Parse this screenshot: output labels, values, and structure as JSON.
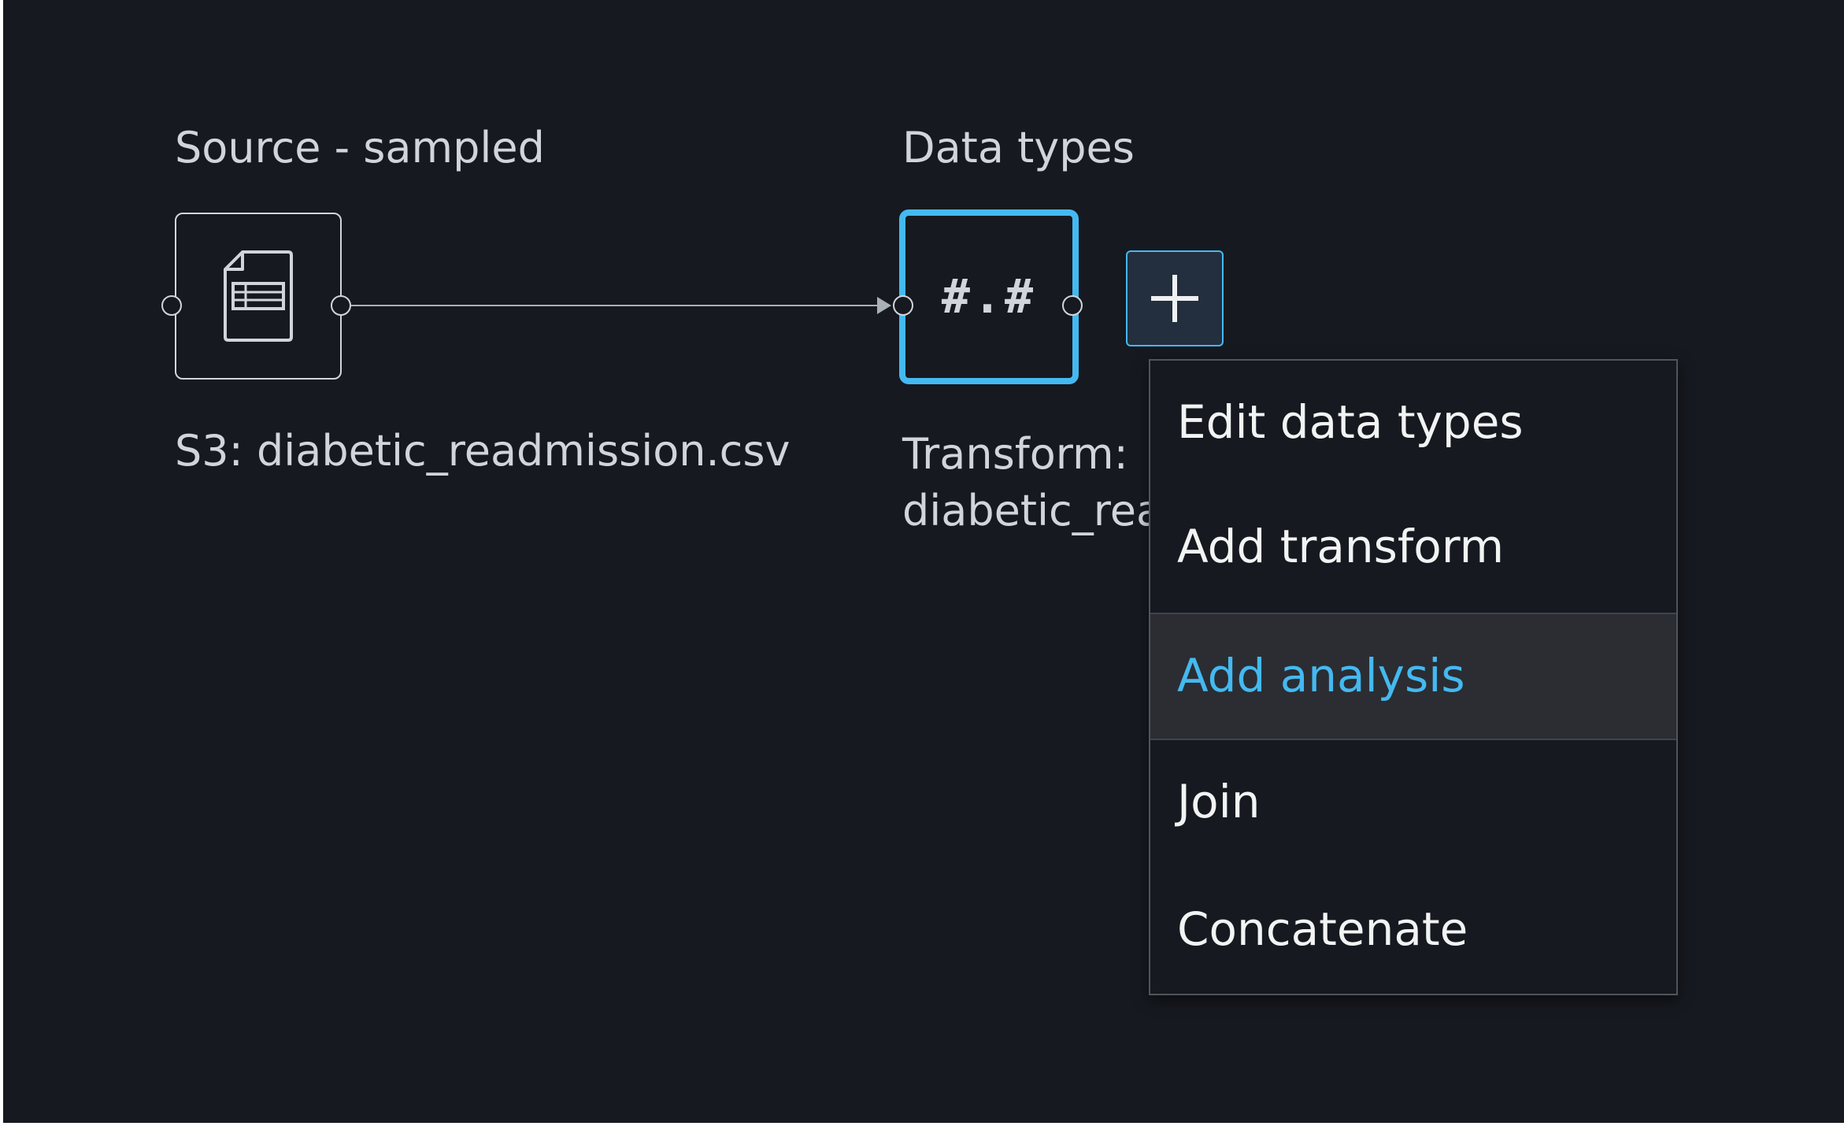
{
  "flow": {
    "source_node": {
      "title": "Source - sampled",
      "label": "S3: diabetic_readmission.csv",
      "icon": "document-table-icon"
    },
    "datatypes_node": {
      "title": "Data types",
      "glyph": "#.#",
      "label_line1": "Transform:",
      "label_line2": "diabetic_rea",
      "icon": "number-format-icon"
    },
    "add_button": {
      "icon": "plus-icon"
    }
  },
  "context_menu": {
    "items": [
      {
        "label": "Edit data types"
      },
      {
        "label": "Add transform"
      },
      {
        "label": "Add analysis",
        "highlighted": true
      },
      {
        "label": "Join"
      },
      {
        "label": "Concatenate"
      }
    ]
  },
  "colors": {
    "canvas_background": "#16191f",
    "accent": "#44b9f0",
    "text": "#d1d5db",
    "menu_text": "#f2f3f3"
  }
}
